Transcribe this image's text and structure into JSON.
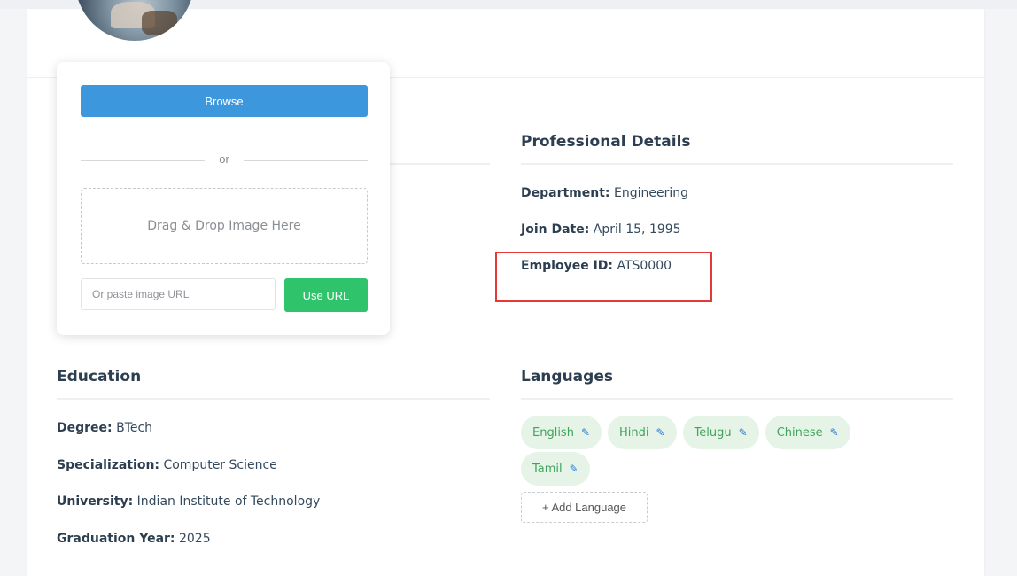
{
  "upload": {
    "browse_label": "Browse",
    "or_label": "or",
    "drop_label": "Drag & Drop Image Here",
    "url_placeholder": "Or paste image URL",
    "use_url_label": "Use URL"
  },
  "professional": {
    "title": "Professional Details",
    "department_label": "Department:",
    "department": "Engineering",
    "join_label": "Join Date:",
    "join_date": "April 15, 1995",
    "employee_label": "Employee ID:",
    "employee_id": "ATS0000"
  },
  "education": {
    "title": "Education",
    "degree_label": "Degree:",
    "degree": "BTech",
    "spec_label": "Specialization:",
    "specialization": "Computer Science",
    "uni_label": "University:",
    "university": "Indian Institute of Technology",
    "grad_label": "Graduation Year:",
    "graduation_year": "2025"
  },
  "languages": {
    "title": "Languages",
    "items": [
      "English",
      "Hindi",
      "Telugu",
      "Chinese",
      "Tamil"
    ],
    "add_label": "+ Add Language"
  },
  "colors": {
    "primary_blue": "#3d97dd",
    "success_green": "#2fc36b",
    "tag_bg": "#e5f4e7",
    "highlight_red": "#e53935"
  },
  "icons": {
    "edit_tag": "pencil-icon"
  }
}
